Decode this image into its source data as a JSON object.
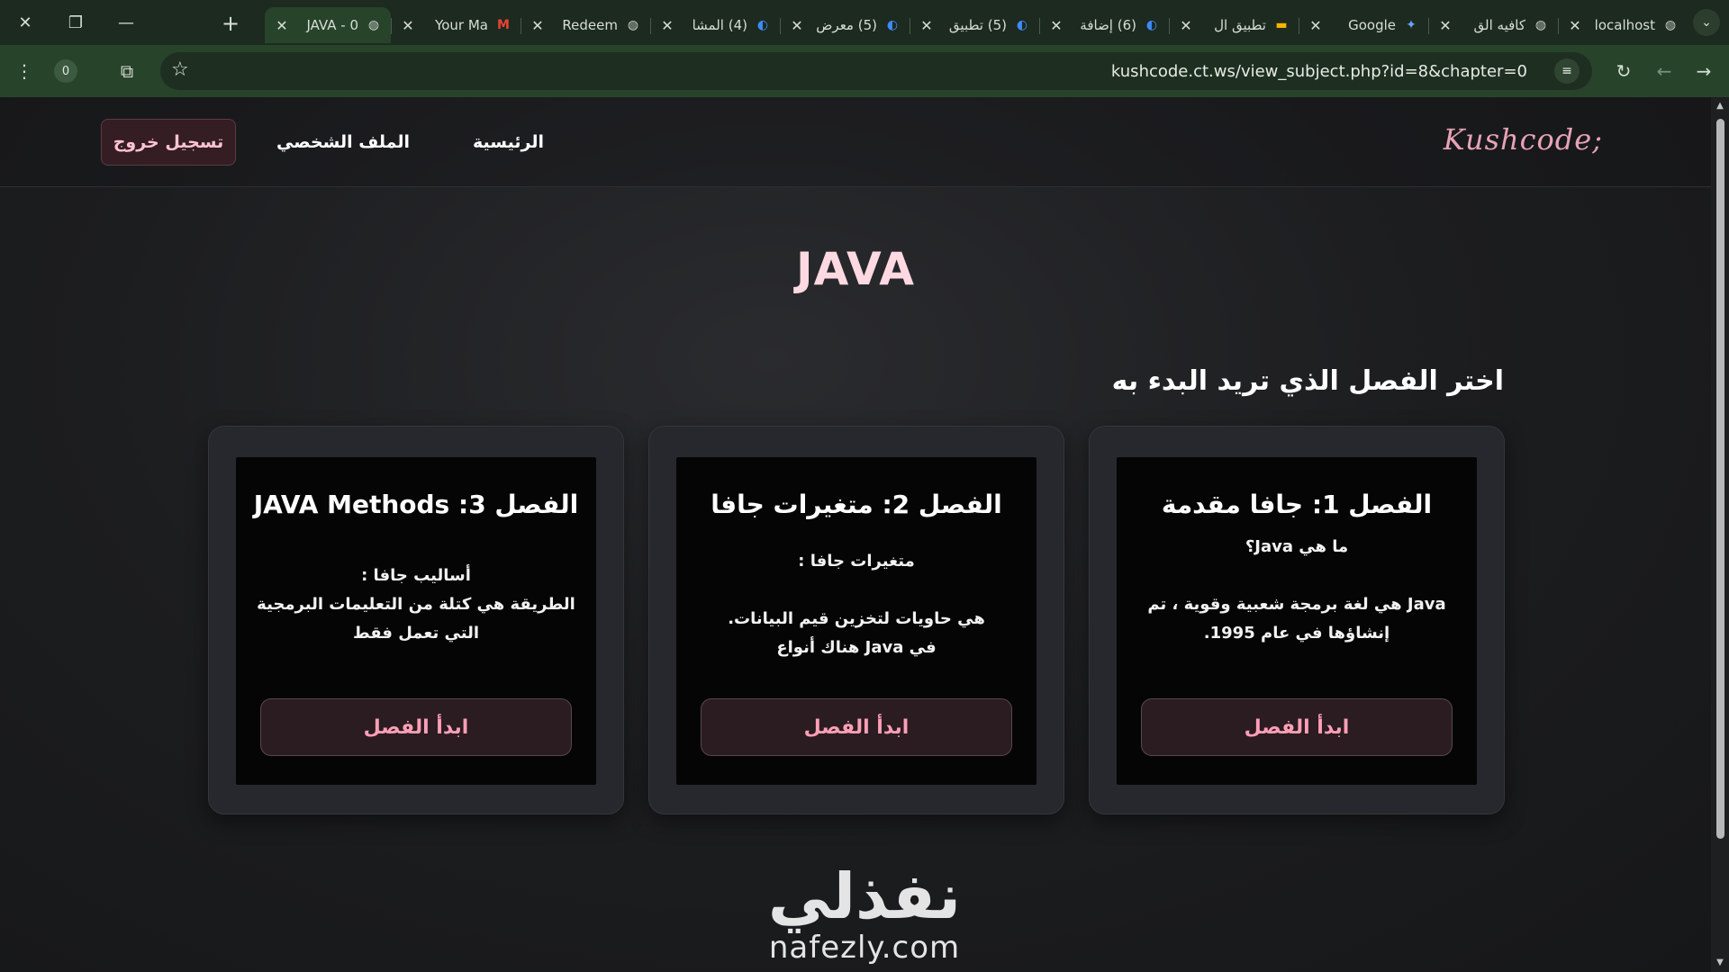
{
  "browser": {
    "tabs": [
      {
        "title": "localhost",
        "favicon": "globe-icon"
      },
      {
        "title": "كافيه الق",
        "favicon": "globe-icon"
      },
      {
        "title": "Google",
        "favicon": "gemini-icon"
      },
      {
        "title": "تطبيق ال",
        "favicon": "slides-icon"
      },
      {
        "title": "(6) إضافة",
        "favicon": "app-icon"
      },
      {
        "title": "(5) تطبيق",
        "favicon": "app-icon"
      },
      {
        "title": "(5) معرض",
        "favicon": "app-icon"
      },
      {
        "title": "(4) المشا",
        "favicon": "app-icon"
      },
      {
        "title": "Redeem",
        "favicon": "globe-icon"
      },
      {
        "title": "Your Ma",
        "favicon": "gmail-icon"
      },
      {
        "title": "JAVA - 0",
        "favicon": "globe-icon",
        "active": true
      }
    ],
    "url": "kushcode.ct.ws/view_subject.php?id=8&chapter=0",
    "extension_badge": "0"
  },
  "nav": {
    "brand": "Kushcode;",
    "home": "الرئيسية",
    "profile": "الملف الشخصي",
    "logout": "تسجيل خروج"
  },
  "subject": {
    "title": "JAVA",
    "heading": "اختر الفصل الذي تريد البدء به"
  },
  "chapters": [
    {
      "title": "الفصل 1: جافا مقدمة",
      "body": "ما هي Java؟\n\nJava هي لغة برمجة شعبية وقوية ، تم إنشاؤها في عام 1995.",
      "button": "ابدأ الفصل"
    },
    {
      "title": "الفصل 2: متغيرات جافا",
      "body": "متغيرات جافا :\n\nهي حاويات لتخزين قيم البيانات.\nفي Java هناك أنواع",
      "button": "ابدأ الفصل"
    },
    {
      "title": "الفصل 3: JAVA Methods",
      "body": "أساليب جافا :\nالطريقة هي كتلة من التعليمات البرمجية التي تعمل فقط",
      "button": "ابدأ الفصل"
    }
  ],
  "watermark": {
    "arabic": "نفذلي",
    "latin": "nafezly.com"
  },
  "colors": {
    "accent_pink": "#ff9fb7",
    "brand_pink": "#e7a3b6",
    "title_pink": "#ffd9e2",
    "chrome_green": "#27442b"
  }
}
